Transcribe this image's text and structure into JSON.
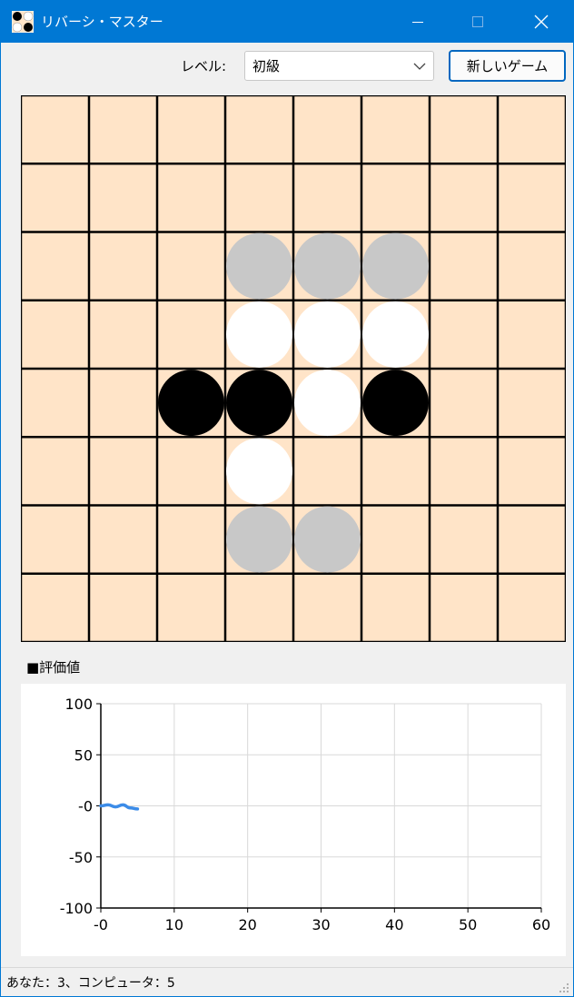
{
  "window": {
    "title": "リバーシ・マスター",
    "title_bar_color": "#0078d4"
  },
  "toolbar": {
    "level_label": "レベル:",
    "level_value": "初級",
    "new_game_label": "新しいゲーム"
  },
  "board": {
    "size": 8,
    "background": "#ffe4c8",
    "cells": [
      ".........",
      "........",
      "...hhh..",
      "...www..",
      "..bbwb..",
      "...w....",
      "...hh...",
      "........"
    ],
    "legend_colors": {
      "black": "#000000",
      "white": "#ffffff",
      "hint": "#c8c8c8"
    }
  },
  "eval": {
    "label": "■評価値"
  },
  "chart_data": {
    "type": "line",
    "series": [
      {
        "x": [
          0,
          1,
          2,
          3,
          4,
          5
        ],
        "values": [
          0,
          1,
          -1,
          1,
          -2,
          -3
        ]
      }
    ],
    "xlim": [
      0,
      60
    ],
    "ylim": [
      -100,
      100
    ],
    "x_ticks": [
      "-0",
      "10",
      "20",
      "30",
      "40",
      "50",
      "60"
    ],
    "y_ticks": [
      "100",
      "50",
      "-0",
      "-50",
      "-100"
    ],
    "grid": true,
    "series_color": "#3c8ce8"
  },
  "status": {
    "text": "あなた：3、コンピュータ：5"
  }
}
